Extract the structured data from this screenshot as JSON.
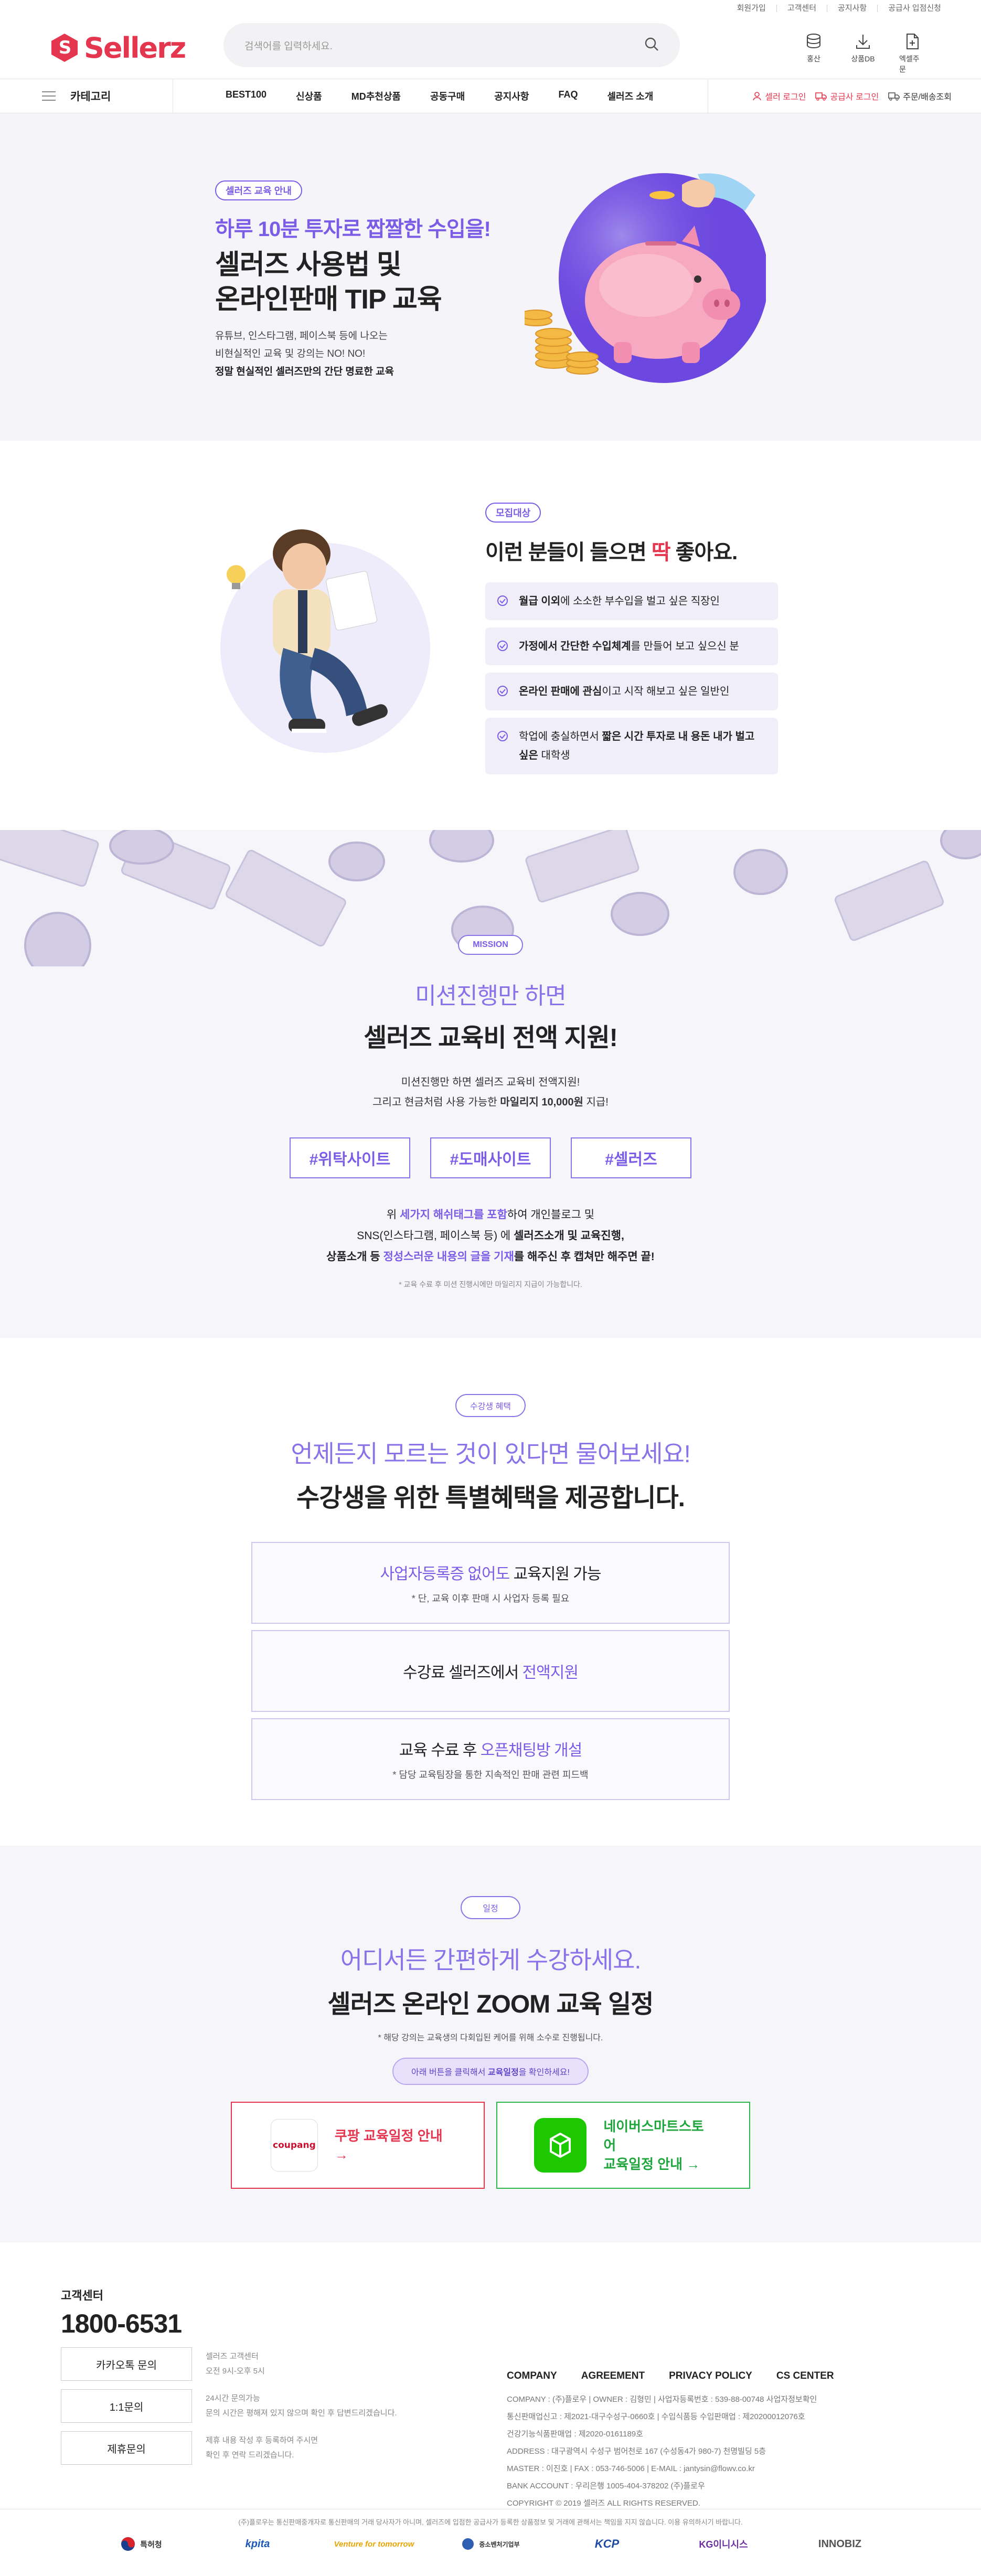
{
  "topbar": {
    "items": [
      "회원가입",
      "고객센터",
      "공지사항",
      "공급사 입점신청"
    ]
  },
  "header": {
    "logo": "Sellerz",
    "search_placeholder": "검색어를 입력하세요.",
    "icons": [
      {
        "icon": "database-icon",
        "label": "홍산"
      },
      {
        "icon": "download-icon",
        "label": "상품DB"
      },
      {
        "icon": "excel-file-icon",
        "label": "엑셀주문"
      }
    ]
  },
  "nav": {
    "category": "카테고리",
    "menu": [
      "BEST100",
      "신상품",
      "MD추천상품",
      "공동구매",
      "공지사항",
      "FAQ",
      "셀러즈 소개"
    ],
    "seller_login": "셀러 로그인",
    "supplier_login": "공급사 로그인",
    "order_lookup": "주문/배송조회"
  },
  "hero": {
    "badge": "셀러즈 교육 안내",
    "headline": "하루 10분 투자로 짭짤한 수입을!",
    "title_line1": "셀러즈 사용법 및",
    "title_line2": "온라인판매 TIP 교육",
    "desc_line1": "유튜브, 인스타그램, 페이스북 등에 나오는",
    "desc_line2": "비현실적인 교육 및 강의는 NO! NO!",
    "desc_line3": "정말 현실적인 셀러즈만의 간단 명료한 교육"
  },
  "target": {
    "badge": "모집대상",
    "title_pre": "이런 분들이 들으면 ",
    "title_hl": "딱",
    "title_post": " 좋아요.",
    "items": [
      {
        "bold": "월급 이외",
        "text": "에 소소한 부수입을 벌고 싶은 직장인"
      },
      {
        "bold": "가정에서 간단한 수입체계",
        "text": "를 만들어 보고 싶으신 분"
      },
      {
        "bold": "온라인 판매에 관심",
        "text": "이고 시작 해보고 싶은 일반인"
      },
      {
        "bold": "짧은 시간 투자로 내 용돈 내가 벌고 싶은",
        "pre": "학업에 충실하면서 ",
        "text": " 대학생"
      }
    ]
  },
  "mission": {
    "badge": "MISSION",
    "title_line1": "미션진행만 하면",
    "title_line2": "셀러즈 교육비 전액 지원!",
    "desc_line1": "미션진행만 하면 셀러즈 교육비 전액지원!",
    "desc_line2_pre": "그리고 현금처럼 사용 가능한 ",
    "desc_line2_bold": "마일리지 10,000원",
    "desc_line2_post": " 지급!",
    "tags": [
      "#위탁사이트",
      "#도매사이트",
      "#셀러즈"
    ],
    "p2_line1_pre": "위 ",
    "p2_line1_hl": "세가지 해쉬태그를 포함",
    "p2_line1_post": "하여 개인블로그 및",
    "p2_line2_pre": "SNS(인스타그램, 페이스북 등) 에 ",
    "p2_line2_bold": "셀러즈소개 및 교육진행,",
    "p2_line3_pre": "상품소개 등 ",
    "p2_line3_hl": "정성스러운 내용의 글을 기재",
    "p2_line3_post": "를 해주신 후 캡쳐만 해주면 끝!",
    "note": "* 교육 수료 후 미션 진행시에만 마일리지 지급이 가능합니다."
  },
  "benefit": {
    "badge": "수강생 혜택",
    "title_line1": "언제든지 모르는 것이 있다면 물어보세요!",
    "title_line2": "수강생을 위한 특별혜택을 제공합니다.",
    "box1_hl": "사업자등록증 없어도",
    "box1_post": " 교육지원 가능",
    "box1_sub": "* 단, 교육 이후 판매 시 사업자 등록 필요",
    "box2_pre": "수강료 셀러즈에서 ",
    "box2_hl": "전액지원",
    "box3_pre": "교육 수료 후 ",
    "box3_hl": "오픈채팅방 개설",
    "box3_sub": "* 담당 교육팀장을 통한 지속적인 판매 관련 피드백"
  },
  "schedule": {
    "badge": "일정",
    "title_line1": "어디서든 간편하게 수강하세요.",
    "title_line2": "셀러즈 온라인 ZOOM 교육 일정",
    "note": "* 해당 강의는 교육생의 다회입된 케어를 위해 소수로 진행됩니다.",
    "pill_pre": "아래 버튼을 클릭해서 ",
    "pill_bold": "교육일정",
    "pill_post": "을 확인하세요!",
    "coupang_logo": "coupang",
    "coupang_label": "쿠팡 교육일정 안내 →",
    "naver_line1": "네이버스마트스토어",
    "naver_line2": "교육일정 안내 →"
  },
  "footer": {
    "cs_title": "고객센터",
    "tel": "1800-6531",
    "buttons": [
      {
        "label": "카카오톡 문의",
        "desc": [
          "셀러즈 고객센터",
          "오전 9시-오후 5시"
        ]
      },
      {
        "label": "1:1문의",
        "desc": [
          "24시간 문의가능",
          "문의 시간은 평해져 있지 않으며 확인 후 답변드리겠습니다."
        ]
      },
      {
        "label": "제휴문의",
        "desc": [
          "제휴 내용 작성 후 등록하여 주시면",
          "확인 후 연락 드리겠습니다."
        ]
      }
    ],
    "links": [
      "COMPANY",
      "AGREEMENT",
      "PRIVACY POLICY",
      "CS CENTER"
    ],
    "info": [
      "COMPANY : (주)플로우   |   OWNER : 김형민   |   사업자등록번호 : 539-88-00748 사업자정보확인",
      "통신판매업신고 : 제2021-대구수성구-0660호   |   수입식품등 수입판매업 : 제20200012076호",
      "건강기능식품판매업 : 제2020-0161189호",
      "ADDRESS : 대구광역시 수성구 범어천로 167 (수성동4가 980-7) 천명빌딩 5층",
      "MASTER : 이진호   |   FAX : 053-746-5006   |   E-MAIL : jantysin@flowv.co.kr",
      "BANK ACCOUNT : 우리은행 1005-404-378202 (주)플로우",
      "COPYRIGHT © 2019 셀러즈 ALL RIGHTS RESERVED."
    ],
    "disclaimer": "(주)플로우는 통신판매중개자로 통신판매의 거래 당사자가 아니며, 셀러즈에 입점한 공급사가 등록한 상품정보 및 거래에 관해서는 책임을 지지 않습니다. 이용 유의하시기 바랍니다.",
    "partner_logos": [
      "특허청",
      "kpita",
      "Venture for tomorrow",
      "중소벤처기업부",
      "KCP",
      "KG이니시스",
      "INNOBIZ"
    ]
  },
  "colors": {
    "brand_red": "#e5364f",
    "accent_purple": "#7b5ce6",
    "naver_green": "#1ec800"
  }
}
